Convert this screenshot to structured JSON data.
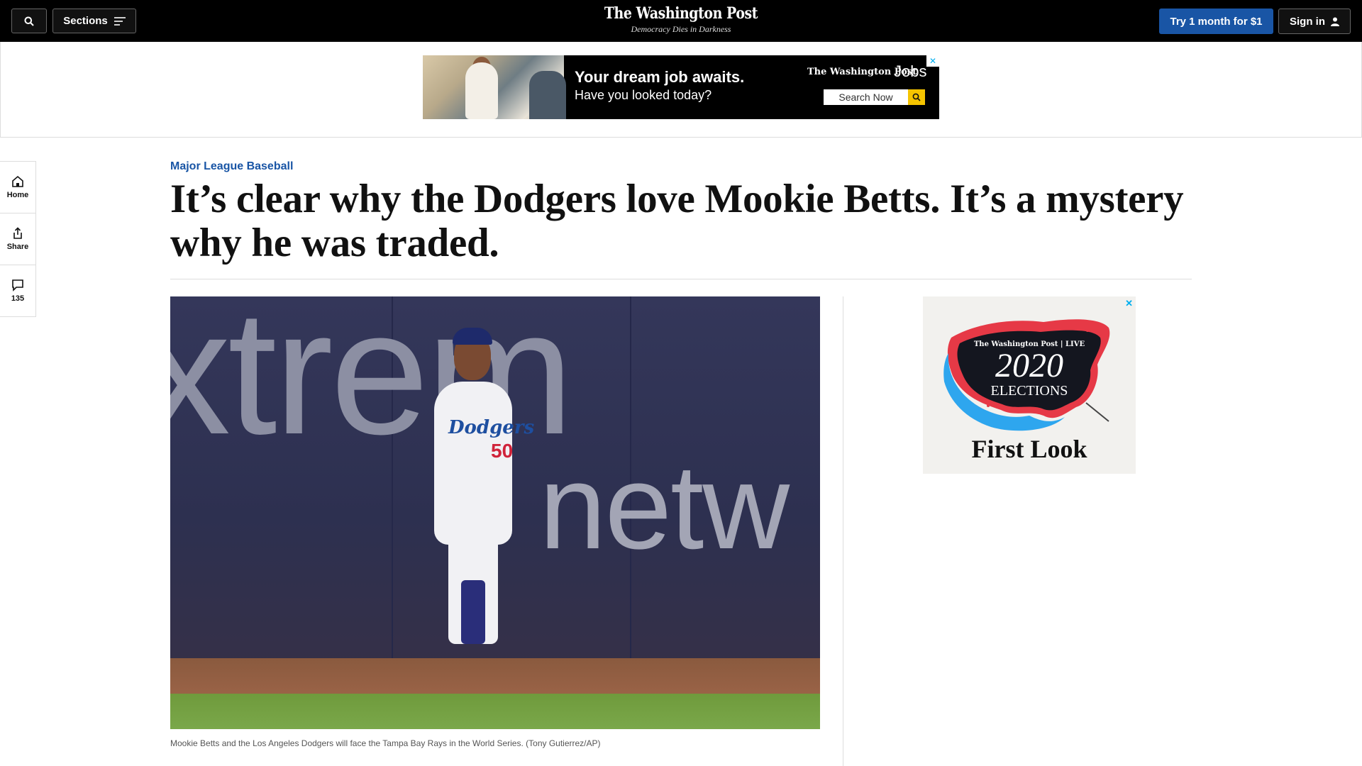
{
  "header": {
    "sections_label": "Sections",
    "logo": "The Washington Post",
    "tagline": "Democracy Dies in Darkness",
    "subscribe_label": "Try 1 month for $1",
    "signin_label": "Sign in"
  },
  "top_ad": {
    "headline": "Your dream job awaits.",
    "subhead": "Have you looked today?",
    "brand": "The Washington Post",
    "product": "Jobs",
    "search_label": "Search Now"
  },
  "side_rail": {
    "home_label": "Home",
    "share_label": "Share",
    "comments_count": "135"
  },
  "article": {
    "kicker": "Major League Baseball",
    "headline": "It’s clear why the Dodgers love Mookie Betts. It’s a mystery why he was traded.",
    "photo_wall_text_1": "xtrem",
    "photo_wall_text_2": "netw",
    "jersey_script": "Dodgers",
    "jersey_number": "50",
    "caption": "Mookie Betts and the Los Angeles Dodgers will face the Tampa Bay Rays in the World Series. (Tony Gutierrez/AP)"
  },
  "right_ad": {
    "brand": "The Washington Post | LIVE",
    "year": "2020",
    "title": "ELECTIONS",
    "tagline": "First Look"
  },
  "colors": {
    "accent_blue": "#1955a5",
    "header_black": "#000000",
    "ad_yellow": "#f5c400"
  }
}
